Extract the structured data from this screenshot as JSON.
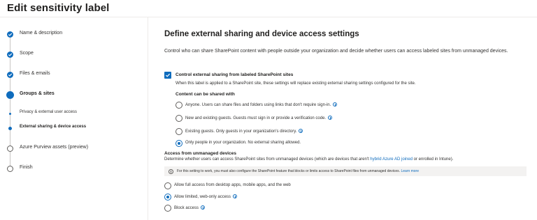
{
  "page": {
    "title": "Edit sensitivity label"
  },
  "colors": {
    "accent": "#0f6cbd",
    "notice_bg": "#f3f2f1",
    "divider": "#edebe9"
  },
  "wizard": {
    "steps": [
      {
        "label": "Name & description",
        "state": "done"
      },
      {
        "label": "Scope",
        "state": "done"
      },
      {
        "label": "Files & emails",
        "state": "done"
      },
      {
        "label": "Groups & sites",
        "state": "current"
      },
      {
        "label": "Privacy & external user access",
        "state": "sub-done"
      },
      {
        "label": "External sharing & device access",
        "state": "sub-current"
      },
      {
        "label": "Azure Purview assets (preview)",
        "state": "todo"
      },
      {
        "label": "Finish",
        "state": "todo"
      }
    ]
  },
  "main": {
    "heading": "Define external sharing and device access settings",
    "intro": "Control who can share SharePoint content with people outside your organization and decide whether users can access labeled sites from unmanaged devices.",
    "sharing": {
      "checkbox_label": "Control external sharing from labeled SharePoint sites",
      "checked": true,
      "description": "When this label is applied to a SharePoint site, these settings will replace existing external sharing settings configured for the site.",
      "subheading": "Content can be shared with",
      "options": [
        {
          "label": "Anyone. Users can share files and folders using links that don't require sign-in.",
          "info_icon": true,
          "selected": false
        },
        {
          "label": "New and existing guests. Guests must sign in or provide a verification code.",
          "info_icon": true,
          "selected": false
        },
        {
          "label": "Existing guests. Only guests in your organization's directory.",
          "info_icon": true,
          "selected": false
        },
        {
          "label": "Only people in your organization. No external sharing allowed.",
          "info_icon": false,
          "selected": true
        }
      ]
    },
    "unmanaged": {
      "title": "Access from unmanaged devices",
      "desc_before": "Determine whether users can access SharePoint sites from unmanaged devices (which are devices that aren't ",
      "desc_link": "hybrid Azure AD joined",
      "desc_after": " or enrolled in Intune).",
      "notice_text": "For this setting to work, you must also configure the SharePoint feature that blocks or limits access to SharePoint files from unmanaged devices.",
      "notice_link": "Learn more",
      "options": [
        {
          "label": "Allow full access from desktop apps, mobile apps, and the web",
          "info_icon": false,
          "selected": false
        },
        {
          "label": "Allow limited, web-only access",
          "info_icon": true,
          "selected": true
        },
        {
          "label": "Block access",
          "info_icon": true,
          "selected": false
        }
      ]
    }
  }
}
